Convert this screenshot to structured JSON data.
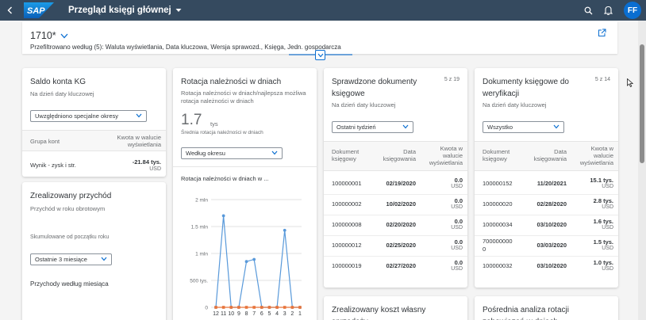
{
  "shell": {
    "app_title": "Przegląd księgi głównej",
    "logo_text": "SAP",
    "avatar": "FF"
  },
  "variant": {
    "name": "1710*",
    "filtered_text": "Przefiltrowano według (5): Waluta wyświetlania, Data kluczowa, Wersja sprawozd., Księga, Jedn. gospodarcza"
  },
  "card_gl_balance": {
    "title": "Saldo konta KG",
    "subtitle": "Na dzień daty kluczowej",
    "select_value": "Uwzględniono specjalne okresy",
    "col1": "Grupa kont",
    "col2": "Kwota w walucie wyświetlania",
    "row_label": "Wynik - zysk i str.",
    "row_value": "-21.84 tys.",
    "row_unit": "USD"
  },
  "card_revenue": {
    "title": "Zrealizowany przychód",
    "subtitle": "Przychód w roku obrotowym",
    "cumulative": "Skumulowane od początku roku",
    "select_value": "Ostatnie 3 miesiące",
    "link": "Przychody według miesiąca"
  },
  "card_receivables": {
    "title": "Rotacja należności w dniach",
    "subtitle": "Rotacja należności w dniach/najlepsza możliwa rotacja należności w dniach",
    "kpi_value": "1.7",
    "kpi_unit": "tys",
    "kpi_label": "Średnia rotacja należności w dniach",
    "select_value": "Według okresu",
    "chart_title": "Rotacja należności w dniach w ..."
  },
  "card_verified": {
    "title": "Sprawdzone dokumenty księgowe",
    "counter": "5 z 19",
    "subtitle": "Na dzień daty kluczowej",
    "select_value": "Ostatni tydzień",
    "col1": "Dokument księgowy",
    "col2": "Data księgowania",
    "col3": "Kwota w walucie wyświetlania",
    "rows": [
      {
        "doc": "100000001",
        "date": "02/19/2020",
        "amount": "0.0",
        "unit": "USD"
      },
      {
        "doc": "100000002",
        "date": "10/02/2020",
        "amount": "0.0",
        "unit": "USD"
      },
      {
        "doc": "100000008",
        "date": "02/20/2020",
        "amount": "0.0",
        "unit": "USD"
      },
      {
        "doc": "100000012",
        "date": "02/25/2020",
        "amount": "0.0",
        "unit": "USD"
      },
      {
        "doc": "100000019",
        "date": "02/27/2020",
        "amount": "0.0",
        "unit": "USD"
      }
    ]
  },
  "card_to_verify": {
    "title": "Dokumenty księgowe do weryfikacji",
    "counter": "5 z 14",
    "subtitle": "Na dzień daty kluczowej",
    "select_value": "Wszystko",
    "col1": "Dokument księgowy",
    "col2": "Data księgowania",
    "col3": "Kwota w walucie wyświetlania",
    "rows": [
      {
        "doc": "100000152",
        "doc2": "",
        "date": "11/20/2021",
        "amount": "15.1 tys.",
        "unit": "USD"
      },
      {
        "doc": "100000020",
        "doc2": "",
        "date": "02/28/2020",
        "amount": "2.8 tys.",
        "unit": "USD"
      },
      {
        "doc": "100000034",
        "doc2": "",
        "date": "03/10/2020",
        "amount": "1.6 tys.",
        "unit": "USD"
      },
      {
        "doc": "700000000",
        "doc2": "0",
        "date": "03/03/2020",
        "amount": "1.5 tys.",
        "unit": "USD"
      },
      {
        "doc": "100000032",
        "doc2": "",
        "date": "03/10/2020",
        "amount": "1.0 tys.",
        "unit": "USD"
      }
    ]
  },
  "card_cogs": {
    "title": "Zrealizowany koszt własny sprzedaży"
  },
  "card_payables": {
    "title": "Pośrednia analiza rotacji zobowiązań w dniach"
  },
  "chart_data": {
    "type": "line",
    "title": "Rotacja należności w dniach w ...",
    "categories": [
      "12",
      "11",
      "10",
      "9",
      "8",
      "7",
      "6",
      "5",
      "4",
      "3",
      "2",
      "1"
    ],
    "ylim": [
      0,
      2000000
    ],
    "y_ticks": [
      "0",
      "500 tys.",
      "1 mln",
      "1.5 mln",
      "2 mln"
    ],
    "series": [
      {
        "color": "#5899da",
        "values": [
          0,
          1700000,
          0,
          0,
          850000,
          890000,
          0,
          0,
          0,
          1430000,
          0,
          0
        ]
      },
      {
        "color": "#e8743b",
        "values": [
          0,
          0,
          0,
          0,
          0,
          0,
          0,
          0,
          0,
          0,
          0,
          0
        ]
      }
    ],
    "grid": true
  }
}
